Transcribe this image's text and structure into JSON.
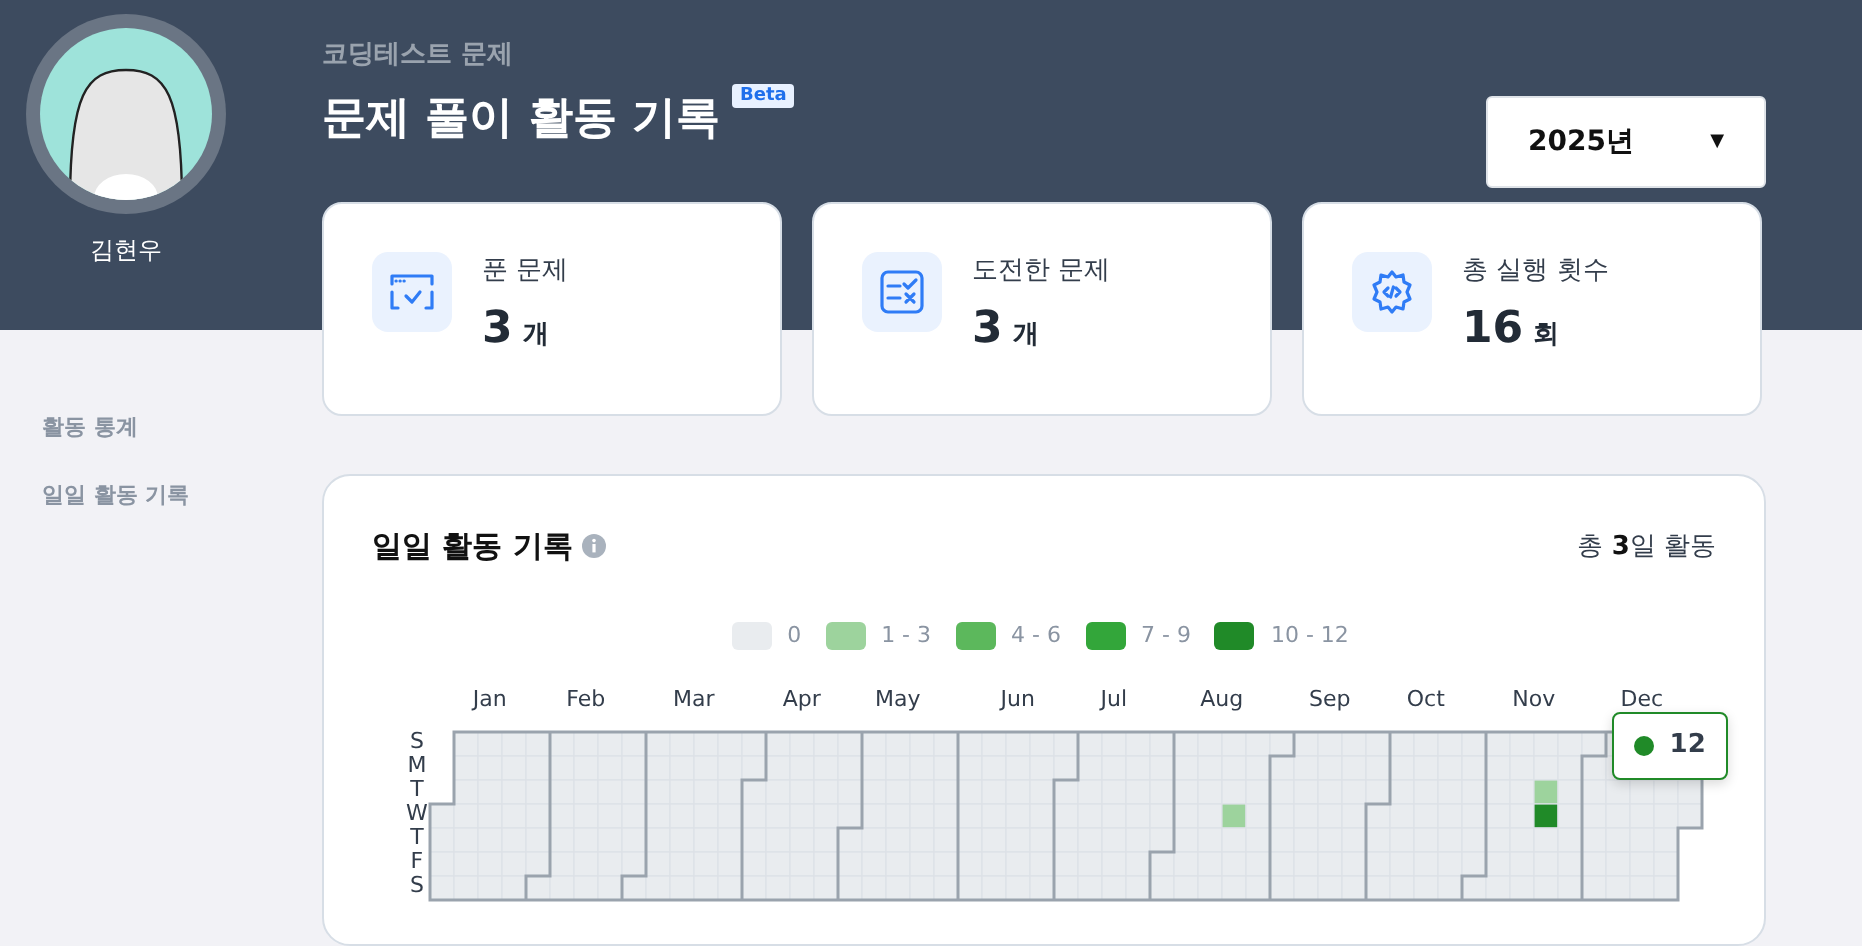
{
  "user": {
    "name": "김현우"
  },
  "sidebar": {
    "items": [
      {
        "label": "활동 통계"
      },
      {
        "label": "일일 활동 기록"
      }
    ]
  },
  "header": {
    "subtitle": "코딩테스트 문제",
    "title": "문제 풀이 활동 기록",
    "badge": "Beta"
  },
  "year_select": {
    "value": "2025년",
    "caret": "▼"
  },
  "stats": [
    {
      "kind": "solved",
      "label": "푼 문제",
      "value": "3",
      "unit": "개"
    },
    {
      "kind": "attempted",
      "label": "도전한 문제",
      "value": "3",
      "unit": "개"
    },
    {
      "kind": "runs",
      "label": "총 실행 횟수",
      "value": "16",
      "unit": "회"
    }
  ],
  "activity": {
    "title": "일일 활동 기록",
    "summary": "총 **3**일 활동",
    "legend": [
      {
        "label": "0",
        "color": "#e9ecef"
      },
      {
        "label": "1 - 3",
        "color": "#9dd39d"
      },
      {
        "label": "4 - 6",
        "color": "#5cb85c"
      },
      {
        "label": "7 - 9",
        "color": "#33a63a"
      },
      {
        "label": "10 - 12",
        "color": "#208a28"
      }
    ],
    "months": [
      "Jan",
      "Feb",
      "Mar",
      "Apr",
      "May",
      "Jun",
      "Jul",
      "Aug",
      "Sep",
      "Oct",
      "Nov",
      "Dec"
    ],
    "weekdays": [
      "S",
      "M",
      "T",
      "W",
      "T",
      "F",
      "S"
    ],
    "weeks": [
      {
        "kind": "first",
        "days": [
          {
            "color": "#e9ecef"
          },
          {
            "color": "#e9ecef"
          },
          {
            "color": "#e9ecef"
          },
          {
            "color": "#e9ecef"
          }
        ]
      },
      {
        "kind": "full",
        "days": [
          {
            "color": "#e9ecef"
          },
          {
            "color": "#e9ecef"
          },
          {
            "color": "#e9ecef"
          },
          {
            "color": "#e9ecef"
          },
          {
            "color": "#e9ecef"
          },
          {
            "color": "#e9ecef"
          },
          {
            "color": "#e9ecef"
          }
        ]
      },
      {
        "kind": "full",
        "days": [
          {
            "color": "#e9ecef"
          },
          {
            "color": "#e9ecef"
          },
          {
            "color": "#e9ecef"
          },
          {
            "color": "#e9ecef"
          },
          {
            "color": "#e9ecef"
          },
          {
            "color": "#e9ecef"
          },
          {
            "color": "#e9ecef"
          }
        ]
      },
      {
        "kind": "full",
        "days": [
          {
            "color": "#e9ecef"
          },
          {
            "color": "#e9ecef"
          },
          {
            "color": "#e9ecef"
          },
          {
            "color": "#e9ecef"
          },
          {
            "color": "#e9ecef"
          },
          {
            "color": "#e9ecef"
          },
          {
            "color": "#e9ecef"
          }
        ]
      },
      {
        "kind": "full",
        "days": [
          {
            "color": "#e9ecef"
          },
          {
            "color": "#e9ecef"
          },
          {
            "color": "#e9ecef"
          },
          {
            "color": "#e9ecef"
          },
          {
            "color": "#e9ecef"
          },
          {
            "color": "#e9ecef"
          },
          {
            "color": "#e9ecef"
          }
        ]
      },
      {
        "kind": "full",
        "days": [
          {
            "color": "#e9ecef"
          },
          {
            "color": "#e9ecef"
          },
          {
            "color": "#e9ecef"
          },
          {
            "color": "#e9ecef"
          },
          {
            "color": "#e9ecef"
          },
          {
            "color": "#e9ecef"
          },
          {
            "color": "#e9ecef"
          }
        ]
      },
      {
        "kind": "full",
        "days": [
          {
            "color": "#e9ecef"
          },
          {
            "color": "#e9ecef"
          },
          {
            "color": "#e9ecef"
          },
          {
            "color": "#e9ecef"
          },
          {
            "color": "#e9ecef"
          },
          {
            "color": "#e9ecef"
          },
          {
            "color": "#e9ecef"
          }
        ]
      },
      {
        "kind": "full",
        "days": [
          {
            "color": "#e9ecef"
          },
          {
            "color": "#e9ecef"
          },
          {
            "color": "#e9ecef"
          },
          {
            "color": "#e9ecef"
          },
          {
            "color": "#e9ecef"
          },
          {
            "color": "#e9ecef"
          },
          {
            "color": "#e9ecef"
          }
        ]
      },
      {
        "kind": "full",
        "days": [
          {
            "color": "#e9ecef"
          },
          {
            "color": "#e9ecef"
          },
          {
            "color": "#e9ecef"
          },
          {
            "color": "#e9ecef"
          },
          {
            "color": "#e9ecef"
          },
          {
            "color": "#e9ecef"
          },
          {
            "color": "#e9ecef"
          }
        ]
      },
      {
        "kind": "full",
        "days": [
          {
            "color": "#e9ecef"
          },
          {
            "color": "#e9ecef"
          },
          {
            "color": "#e9ecef"
          },
          {
            "color": "#e9ecef"
          },
          {
            "color": "#e9ecef"
          },
          {
            "color": "#e9ecef"
          },
          {
            "color": "#e9ecef"
          }
        ]
      },
      {
        "kind": "full",
        "days": [
          {
            "color": "#e9ecef"
          },
          {
            "color": "#e9ecef"
          },
          {
            "color": "#e9ecef"
          },
          {
            "color": "#e9ecef"
          },
          {
            "color": "#e9ecef"
          },
          {
            "color": "#e9ecef"
          },
          {
            "color": "#e9ecef"
          }
        ]
      },
      {
        "kind": "full",
        "days": [
          {
            "color": "#e9ecef"
          },
          {
            "color": "#e9ecef"
          },
          {
            "color": "#e9ecef"
          },
          {
            "color": "#e9ecef"
          },
          {
            "color": "#e9ecef"
          },
          {
            "color": "#e9ecef"
          },
          {
            "color": "#e9ecef"
          }
        ]
      },
      {
        "kind": "full",
        "days": [
          {
            "color": "#e9ecef"
          },
          {
            "color": "#e9ecef"
          },
          {
            "color": "#e9ecef"
          },
          {
            "color": "#e9ecef"
          },
          {
            "color": "#e9ecef"
          },
          {
            "color": "#e9ecef"
          },
          {
            "color": "#e9ecef"
          }
        ]
      },
      {
        "kind": "full",
        "days": [
          {
            "color": "#e9ecef"
          },
          {
            "color": "#e9ecef"
          },
          {
            "color": "#e9ecef"
          },
          {
            "color": "#e9ecef"
          },
          {
            "color": "#e9ecef"
          },
          {
            "color": "#e9ecef"
          },
          {
            "color": "#e9ecef"
          }
        ]
      },
      {
        "kind": "full",
        "days": [
          {
            "color": "#e9ecef"
          },
          {
            "color": "#e9ecef"
          },
          {
            "color": "#e9ecef"
          },
          {
            "color": "#e9ecef"
          },
          {
            "color": "#e9ecef"
          },
          {
            "color": "#e9ecef"
          },
          {
            "color": "#e9ecef"
          }
        ]
      },
      {
        "kind": "full",
        "days": [
          {
            "color": "#e9ecef"
          },
          {
            "color": "#e9ecef"
          },
          {
            "color": "#e9ecef"
          },
          {
            "color": "#e9ecef"
          },
          {
            "color": "#e9ecef"
          },
          {
            "color": "#e9ecef"
          },
          {
            "color": "#e9ecef"
          }
        ]
      },
      {
        "kind": "full",
        "days": [
          {
            "color": "#e9ecef"
          },
          {
            "color": "#e9ecef"
          },
          {
            "color": "#e9ecef"
          },
          {
            "color": "#e9ecef"
          },
          {
            "color": "#e9ecef"
          },
          {
            "color": "#e9ecef"
          },
          {
            "color": "#e9ecef"
          }
        ]
      },
      {
        "kind": "full",
        "days": [
          {
            "color": "#e9ecef"
          },
          {
            "color": "#e9ecef"
          },
          {
            "color": "#e9ecef"
          },
          {
            "color": "#e9ecef"
          },
          {
            "color": "#e9ecef"
          },
          {
            "color": "#e9ecef"
          },
          {
            "color": "#e9ecef"
          }
        ]
      },
      {
        "kind": "full",
        "days": [
          {
            "color": "#e9ecef"
          },
          {
            "color": "#e9ecef"
          },
          {
            "color": "#e9ecef"
          },
          {
            "color": "#e9ecef"
          },
          {
            "color": "#e9ecef"
          },
          {
            "color": "#e9ecef"
          },
          {
            "color": "#e9ecef"
          }
        ]
      },
      {
        "kind": "full",
        "days": [
          {
            "color": "#e9ecef"
          },
          {
            "color": "#e9ecef"
          },
          {
            "color": "#e9ecef"
          },
          {
            "color": "#e9ecef"
          },
          {
            "color": "#e9ecef"
          },
          {
            "color": "#e9ecef"
          },
          {
            "color": "#e9ecef"
          }
        ]
      },
      {
        "kind": "full",
        "days": [
          {
            "color": "#e9ecef"
          },
          {
            "color": "#e9ecef"
          },
          {
            "color": "#e9ecef"
          },
          {
            "color": "#e9ecef"
          },
          {
            "color": "#e9ecef"
          },
          {
            "color": "#e9ecef"
          },
          {
            "color": "#e9ecef"
          }
        ]
      },
      {
        "kind": "full",
        "days": [
          {
            "color": "#e9ecef"
          },
          {
            "color": "#e9ecef"
          },
          {
            "color": "#e9ecef"
          },
          {
            "color": "#e9ecef"
          },
          {
            "color": "#e9ecef"
          },
          {
            "color": "#e9ecef"
          },
          {
            "color": "#e9ecef"
          }
        ]
      },
      {
        "kind": "full",
        "days": [
          {
            "color": "#e9ecef"
          },
          {
            "color": "#e9ecef"
          },
          {
            "color": "#e9ecef"
          },
          {
            "color": "#e9ecef"
          },
          {
            "color": "#e9ecef"
          },
          {
            "color": "#e9ecef"
          },
          {
            "color": "#e9ecef"
          }
        ]
      },
      {
        "kind": "full",
        "days": [
          {
            "color": "#e9ecef"
          },
          {
            "color": "#e9ecef"
          },
          {
            "color": "#e9ecef"
          },
          {
            "color": "#e9ecef"
          },
          {
            "color": "#e9ecef"
          },
          {
            "color": "#e9ecef"
          },
          {
            "color": "#e9ecef"
          }
        ]
      },
      {
        "kind": "full",
        "days": [
          {
            "color": "#e9ecef"
          },
          {
            "color": "#e9ecef"
          },
          {
            "color": "#e9ecef"
          },
          {
            "color": "#e9ecef"
          },
          {
            "color": "#e9ecef"
          },
          {
            "color": "#e9ecef"
          },
          {
            "color": "#e9ecef"
          }
        ]
      },
      {
        "kind": "full",
        "days": [
          {
            "color": "#e9ecef"
          },
          {
            "color": "#e9ecef"
          },
          {
            "color": "#e9ecef"
          },
          {
            "color": "#e9ecef"
          },
          {
            "color": "#e9ecef"
          },
          {
            "color": "#e9ecef"
          },
          {
            "color": "#e9ecef"
          }
        ]
      },
      {
        "kind": "full",
        "days": [
          {
            "color": "#e9ecef"
          },
          {
            "color": "#e9ecef"
          },
          {
            "color": "#e9ecef"
          },
          {
            "color": "#e9ecef"
          },
          {
            "color": "#e9ecef"
          },
          {
            "color": "#e9ecef"
          },
          {
            "color": "#e9ecef"
          }
        ]
      },
      {
        "kind": "full",
        "days": [
          {
            "color": "#e9ecef"
          },
          {
            "color": "#e9ecef"
          },
          {
            "color": "#e9ecef"
          },
          {
            "color": "#e9ecef"
          },
          {
            "color": "#e9ecef"
          },
          {
            "color": "#e9ecef"
          },
          {
            "color": "#e9ecef"
          }
        ]
      },
      {
        "kind": "full",
        "days": [
          {
            "color": "#e9ecef"
          },
          {
            "color": "#e9ecef"
          },
          {
            "color": "#e9ecef"
          },
          {
            "color": "#e9ecef"
          },
          {
            "color": "#e9ecef"
          },
          {
            "color": "#e9ecef"
          },
          {
            "color": "#e9ecef"
          }
        ]
      },
      {
        "kind": "full",
        "days": [
          {
            "color": "#e9ecef"
          },
          {
            "color": "#e9ecef"
          },
          {
            "color": "#e9ecef"
          },
          {
            "color": "#e9ecef"
          },
          {
            "color": "#e9ecef"
          },
          {
            "color": "#e9ecef"
          },
          {
            "color": "#e9ecef"
          }
        ]
      },
      {
        "kind": "full",
        "days": [
          {
            "color": "#e9ecef"
          },
          {
            "color": "#e9ecef"
          },
          {
            "color": "#e9ecef"
          },
          {
            "color": "#e9ecef"
          },
          {
            "color": "#e9ecef"
          },
          {
            "color": "#e9ecef"
          },
          {
            "color": "#e9ecef"
          }
        ]
      },
      {
        "kind": "full",
        "days": [
          {
            "color": "#e9ecef"
          },
          {
            "color": "#e9ecef"
          },
          {
            "color": "#e9ecef"
          },
          {
            "color": "#e9ecef"
          },
          {
            "color": "#e9ecef"
          },
          {
            "color": "#e9ecef"
          },
          {
            "color": "#e9ecef"
          }
        ]
      },
      {
        "kind": "full",
        "days": [
          {
            "color": "#e9ecef"
          },
          {
            "color": "#e9ecef"
          },
          {
            "color": "#e9ecef"
          },
          {
            "color": "#e9ecef"
          },
          {
            "color": "#e9ecef"
          },
          {
            "color": "#e9ecef"
          },
          {
            "color": "#e9ecef"
          }
        ]
      },
      {
        "kind": "full",
        "days": [
          {
            "color": "#e9ecef"
          },
          {
            "color": "#e9ecef"
          },
          {
            "color": "#e9ecef"
          },
          {
            "color": "#9dd39d"
          },
          {
            "color": "#e9ecef"
          },
          {
            "color": "#e9ecef"
          },
          {
            "color": "#e9ecef"
          }
        ]
      },
      {
        "kind": "full",
        "days": [
          {
            "color": "#e9ecef"
          },
          {
            "color": "#e9ecef"
          },
          {
            "color": "#e9ecef"
          },
          {
            "color": "#e9ecef"
          },
          {
            "color": "#e9ecef"
          },
          {
            "color": "#e9ecef"
          },
          {
            "color": "#e9ecef"
          }
        ]
      },
      {
        "kind": "full",
        "days": [
          {
            "color": "#e9ecef"
          },
          {
            "color": "#e9ecef"
          },
          {
            "color": "#e9ecef"
          },
          {
            "color": "#e9ecef"
          },
          {
            "color": "#e9ecef"
          },
          {
            "color": "#e9ecef"
          },
          {
            "color": "#e9ecef"
          }
        ]
      },
      {
        "kind": "full",
        "days": [
          {
            "color": "#e9ecef"
          },
          {
            "color": "#e9ecef"
          },
          {
            "color": "#e9ecef"
          },
          {
            "color": "#e9ecef"
          },
          {
            "color": "#e9ecef"
          },
          {
            "color": "#e9ecef"
          },
          {
            "color": "#e9ecef"
          }
        ]
      },
      {
        "kind": "full",
        "days": [
          {
            "color": "#e9ecef"
          },
          {
            "color": "#e9ecef"
          },
          {
            "color": "#e9ecef"
          },
          {
            "color": "#e9ecef"
          },
          {
            "color": "#e9ecef"
          },
          {
            "color": "#e9ecef"
          },
          {
            "color": "#e9ecef"
          }
        ]
      },
      {
        "kind": "full",
        "days": [
          {
            "color": "#e9ecef"
          },
          {
            "color": "#e9ecef"
          },
          {
            "color": "#e9ecef"
          },
          {
            "color": "#e9ecef"
          },
          {
            "color": "#e9ecef"
          },
          {
            "color": "#e9ecef"
          },
          {
            "color": "#e9ecef"
          }
        ]
      },
      {
        "kind": "full",
        "days": [
          {
            "color": "#e9ecef"
          },
          {
            "color": "#e9ecef"
          },
          {
            "color": "#e9ecef"
          },
          {
            "color": "#e9ecef"
          },
          {
            "color": "#e9ecef"
          },
          {
            "color": "#e9ecef"
          },
          {
            "color": "#e9ecef"
          }
        ]
      },
      {
        "kind": "full",
        "days": [
          {
            "color": "#e9ecef"
          },
          {
            "color": "#e9ecef"
          },
          {
            "color": "#e9ecef"
          },
          {
            "color": "#e9ecef"
          },
          {
            "color": "#e9ecef"
          },
          {
            "color": "#e9ecef"
          },
          {
            "color": "#e9ecef"
          }
        ]
      },
      {
        "kind": "full",
        "days": [
          {
            "color": "#e9ecef"
          },
          {
            "color": "#e9ecef"
          },
          {
            "color": "#e9ecef"
          },
          {
            "color": "#e9ecef"
          },
          {
            "color": "#e9ecef"
          },
          {
            "color": "#e9ecef"
          },
          {
            "color": "#e9ecef"
          }
        ]
      },
      {
        "kind": "full",
        "days": [
          {
            "color": "#e9ecef"
          },
          {
            "color": "#e9ecef"
          },
          {
            "color": "#e9ecef"
          },
          {
            "color": "#e9ecef"
          },
          {
            "color": "#e9ecef"
          },
          {
            "color": "#e9ecef"
          },
          {
            "color": "#e9ecef"
          }
        ]
      },
      {
        "kind": "full",
        "days": [
          {
            "color": "#e9ecef"
          },
          {
            "color": "#e9ecef"
          },
          {
            "color": "#e9ecef"
          },
          {
            "color": "#e9ecef"
          },
          {
            "color": "#e9ecef"
          },
          {
            "color": "#e9ecef"
          },
          {
            "color": "#e9ecef"
          }
        ]
      },
      {
        "kind": "full",
        "days": [
          {
            "color": "#e9ecef"
          },
          {
            "color": "#e9ecef"
          },
          {
            "color": "#e9ecef"
          },
          {
            "color": "#e9ecef"
          },
          {
            "color": "#e9ecef"
          },
          {
            "color": "#e9ecef"
          },
          {
            "color": "#e9ecef"
          }
        ]
      },
      {
        "kind": "full",
        "days": [
          {
            "color": "#e9ecef"
          },
          {
            "color": "#e9ecef"
          },
          {
            "color": "#e9ecef"
          },
          {
            "color": "#e9ecef"
          },
          {
            "color": "#e9ecef"
          },
          {
            "color": "#e9ecef"
          },
          {
            "color": "#e9ecef"
          }
        ]
      },
      {
        "kind": "full",
        "days": [
          {
            "color": "#e9ecef"
          },
          {
            "color": "#e9ecef"
          },
          {
            "color": "#9dd39d"
          },
          {
            "color": "#208a28"
          },
          {
            "color": "#e9ecef"
          },
          {
            "color": "#e9ecef"
          },
          {
            "color": "#e9ecef"
          }
        ]
      },
      {
        "kind": "full",
        "days": [
          {
            "color": "#e9ecef"
          },
          {
            "color": "#e9ecef"
          },
          {
            "color": "#e9ecef"
          },
          {
            "color": "#e9ecef"
          },
          {
            "color": "#e9ecef"
          },
          {
            "color": "#e9ecef"
          },
          {
            "color": "#e9ecef"
          }
        ]
      },
      {
        "kind": "full",
        "days": [
          {
            "color": "#e9ecef"
          },
          {
            "color": "#e9ecef"
          },
          {
            "color": "#e9ecef"
          },
          {
            "color": "#e9ecef"
          },
          {
            "color": "#e9ecef"
          },
          {
            "color": "#e9ecef"
          },
          {
            "color": "#e9ecef"
          }
        ]
      },
      {
        "kind": "full",
        "days": [
          {
            "color": "#e9ecef"
          },
          {
            "color": "#e9ecef"
          },
          {
            "color": "#e9ecef"
          },
          {
            "color": "#e9ecef"
          },
          {
            "color": "#e9ecef"
          },
          {
            "color": "#e9ecef"
          },
          {
            "color": "#e9ecef"
          }
        ]
      },
      {
        "kind": "covered",
        "days": [
          {
            "color": "#e9ecef"
          },
          {
            "color": "#e9ecef"
          },
          {
            "color": "#e9ecef"
          },
          {
            "color": "#e9ecef"
          },
          {
            "color": "#e9ecef"
          }
        ]
      },
      {
        "kind": "covered",
        "days": [
          {
            "color": "#e9ecef"
          },
          {
            "color": "#e9ecef"
          },
          {
            "color": "#e9ecef"
          },
          {
            "color": "#e9ecef"
          },
          {
            "color": "#e9ecef"
          }
        ]
      },
      {
        "kind": "covered",
        "days": [
          {
            "color": "#e9ecef"
          },
          {
            "color": "#e9ecef"
          }
        ]
      }
    ],
    "tooltip": {
      "value": "12",
      "color": "#208a28"
    }
  }
}
